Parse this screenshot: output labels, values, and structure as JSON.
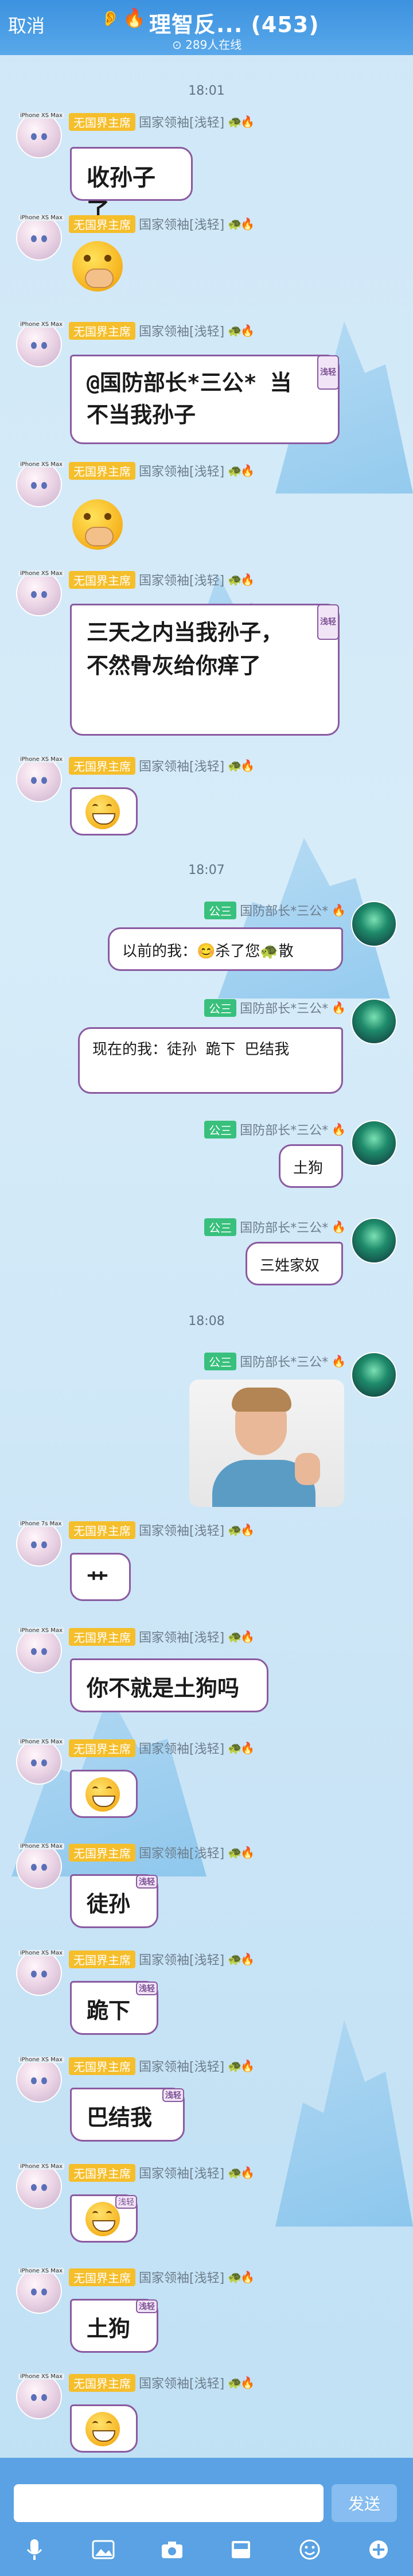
{
  "header": {
    "cancel_label": "取消",
    "title": "理智反... (453)",
    "online": "289人在线"
  },
  "icons": {
    "ear": "ear-icon",
    "fire": "fire-icon",
    "mic": "microphone-icon",
    "image": "image-icon",
    "camera": "camera-icon",
    "gallery": "gallery-icon",
    "emoji": "emoji-icon",
    "plus": "plus-icon"
  },
  "me": {
    "device": "iPhone XS Max",
    "device_short": "iPhone 7s Max",
    "badge": "无国界主席",
    "title": "国家领袖[浅轻]"
  },
  "them": {
    "badge": "公三",
    "title": "国防部长*三公*"
  },
  "tag_label": "浅轻",
  "timestamps": [
    "18:01",
    "18:07",
    "18:08"
  ],
  "messages": {
    "m1": "收孙子了",
    "m3": "@国防部长*三公* 当不当我孙子",
    "m5": "三天之内当我孙子，不然骨灰给你痒了",
    "t1": "以前的我：😊杀了您🐢散",
    "t2": "现在的我：徒孙 跪下 巴结我",
    "t3": "土狗",
    "t4": "三姓家奴",
    "m8": "艹",
    "m9": "你不就是土狗吗",
    "m11": "徒孙",
    "m12": "跪下",
    "m13": "巴结我",
    "m15": "土狗"
  },
  "input": {
    "placeholder": ""
  },
  "send_label": "发送"
}
